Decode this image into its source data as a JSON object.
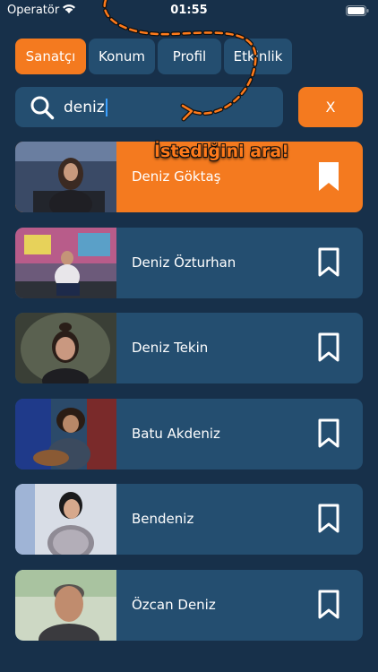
{
  "status_bar": {
    "carrier": "Operatör",
    "time": "01:55"
  },
  "tabs": [
    {
      "label": "Sanatçı",
      "active": true
    },
    {
      "label": "Konum",
      "active": false
    },
    {
      "label": "Profil",
      "active": false
    },
    {
      "label": "Etkinlik",
      "active": false
    }
  ],
  "search": {
    "value": "deniz",
    "clear_label": "X"
  },
  "hint": {
    "text": "İstediğini ara!"
  },
  "results": [
    {
      "name": "Deniz Göktaş",
      "selected": true,
      "bookmarked": true
    },
    {
      "name": "Deniz Özturhan",
      "selected": false,
      "bookmarked": false
    },
    {
      "name": "Deniz Tekin",
      "selected": false,
      "bookmarked": false
    },
    {
      "name": "Batu Akdeniz",
      "selected": false,
      "bookmarked": false
    },
    {
      "name": "Bendeniz",
      "selected": false,
      "bookmarked": false
    },
    {
      "name": "Özcan Deniz",
      "selected": false,
      "bookmarked": false
    }
  ],
  "colors": {
    "background": "#17304a",
    "card": "#244e70",
    "accent": "#f47a1f"
  }
}
